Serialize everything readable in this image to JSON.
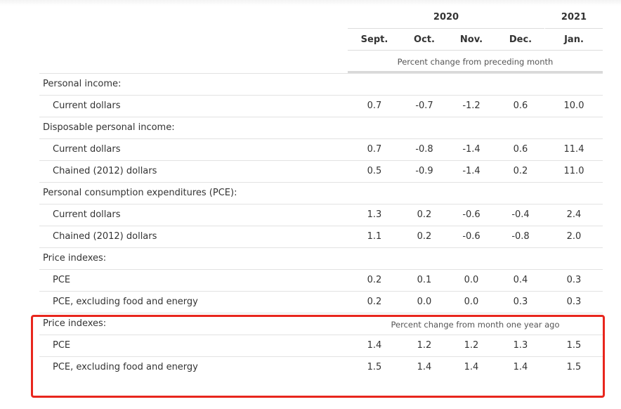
{
  "header": {
    "years": [
      "2020",
      "2021"
    ],
    "months": [
      "Sept.",
      "Oct.",
      "Nov.",
      "Dec.",
      "Jan."
    ],
    "caption_monthly": "Percent change from preceding month",
    "caption_yoy": "Percent change from month one year ago"
  },
  "rows": [
    {
      "label": "Personal income:",
      "kind": "section"
    },
    {
      "label": "Current dollars",
      "kind": "item",
      "values": [
        "0.7",
        "-0.7",
        "-1.2",
        "0.6",
        "10.0"
      ]
    },
    {
      "label": "Disposable personal income:",
      "kind": "section"
    },
    {
      "label": "Current dollars",
      "kind": "item",
      "values": [
        "0.7",
        "-0.8",
        "-1.4",
        "0.6",
        "11.4"
      ]
    },
    {
      "label": "Chained (2012) dollars",
      "kind": "item",
      "values": [
        "0.5",
        "-0.9",
        "-1.4",
        "0.2",
        "11.0"
      ]
    },
    {
      "label": "Personal consumption expenditures (PCE):",
      "kind": "section"
    },
    {
      "label": "Current dollars",
      "kind": "item",
      "values": [
        "1.3",
        "0.2",
        "-0.6",
        "-0.4",
        "2.4"
      ]
    },
    {
      "label": "Chained (2012) dollars",
      "kind": "item",
      "values": [
        "1.1",
        "0.2",
        "-0.6",
        "-0.8",
        "2.0"
      ]
    },
    {
      "label": "Price indexes:",
      "kind": "section"
    },
    {
      "label": "PCE",
      "kind": "item",
      "values": [
        "0.2",
        "0.1",
        "0.0",
        "0.4",
        "0.3"
      ]
    },
    {
      "label": "PCE, excluding food and energy",
      "kind": "item",
      "values": [
        "0.2",
        "0.0",
        "0.0",
        "0.3",
        "0.3"
      ]
    },
    {
      "label": "Price indexes:",
      "kind": "section-yoy"
    },
    {
      "label": "PCE",
      "kind": "item",
      "values": [
        "1.4",
        "1.2",
        "1.2",
        "1.3",
        "1.5"
      ]
    },
    {
      "label": "PCE, excluding food and energy",
      "kind": "item",
      "values": [
        "1.5",
        "1.4",
        "1.4",
        "1.4",
        "1.5"
      ]
    }
  ],
  "highlight_color": "#e8261d"
}
